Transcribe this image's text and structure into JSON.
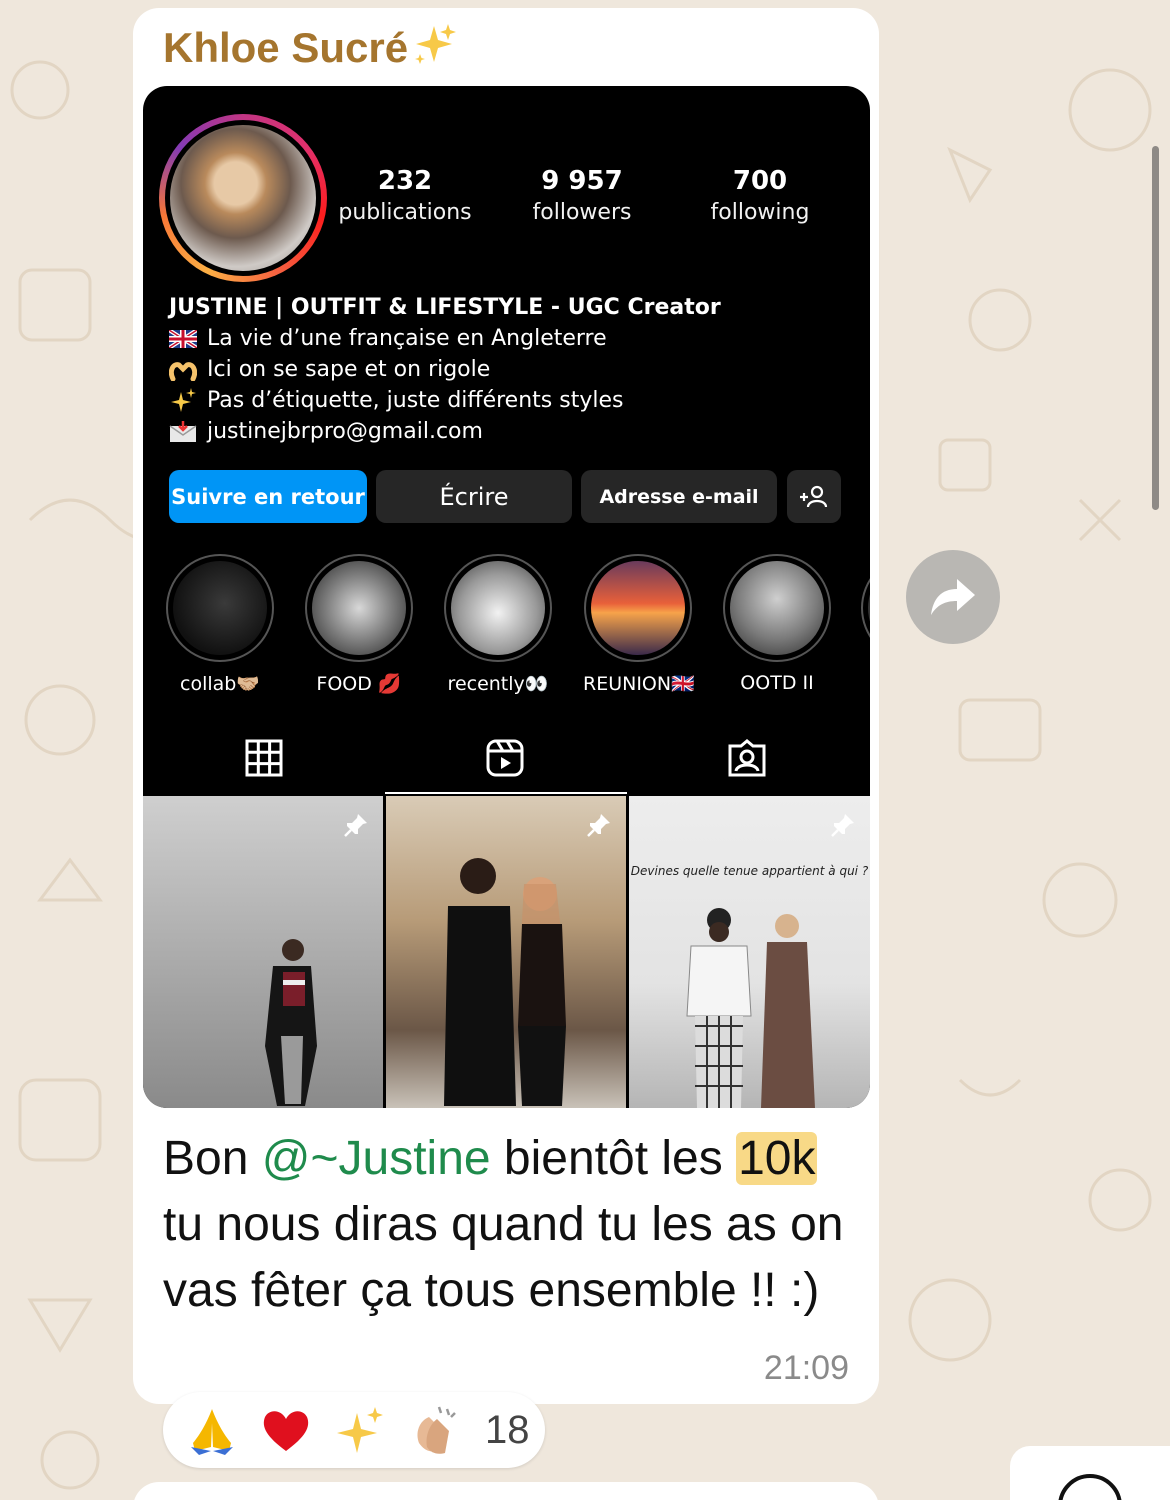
{
  "chat": {
    "sender_name": "Khloe Sucré",
    "message_text_before": "Bon ",
    "mention": "@~Justine",
    "message_text_middle": " bientôt les ",
    "highlight": "10k",
    "message_text_after": " tu nous diras quand tu les as on vas fêter ça tous ensemble !! :)",
    "time": "21:09",
    "reactions": {
      "emojis": [
        "folded-hands",
        "red-heart",
        "sparkles",
        "clapping-hands"
      ],
      "count": "18"
    }
  },
  "profile": {
    "stats": [
      {
        "value": "232",
        "label": "publications"
      },
      {
        "value": "9 957",
        "label": "followers"
      },
      {
        "value": "700",
        "label": "following"
      }
    ],
    "bio": {
      "title": "JUSTINE | OUTFIT & LIFESTYLE - UGC Creator",
      "lines": [
        {
          "icon": "uk-flag-icon",
          "text": "La vie d’une française en Angleterre"
        },
        {
          "icon": "heart-hands-icon",
          "text": "Ici on se sape et on rigole"
        },
        {
          "icon": "sparkles-icon",
          "text": "Pas d’étiquette, juste différents styles"
        },
        {
          "icon": "envelope-icon",
          "text": "justinejbrpro@gmail.com"
        }
      ]
    },
    "buttons": {
      "follow_back": "Suivre en retour",
      "message": "Écrire",
      "email": "Adresse e-mail"
    },
    "highlights": [
      {
        "label": "collab🤝🏼"
      },
      {
        "label": "FOOD 💋"
      },
      {
        "label": "recently👀"
      },
      {
        "label": "REUNION🇬🇧"
      },
      {
        "label": "OOTD II"
      }
    ],
    "posts": [
      {
        "pinned": true
      },
      {
        "pinned": true
      },
      {
        "pinned": true,
        "caption": "Devines quelle tenue appartient à qui ?"
      }
    ]
  },
  "colors": {
    "sender": "#a5752e",
    "mention": "#1f8b4c",
    "highlight_bg": "#f8d987",
    "ig_primary": "#0095f6",
    "chat_bg": "#efe7dc"
  }
}
